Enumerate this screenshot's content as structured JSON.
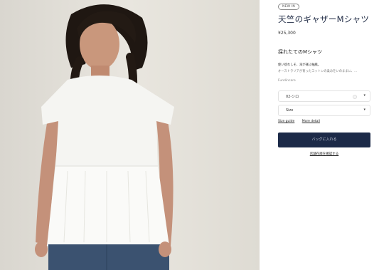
{
  "product": {
    "badge": "NEW IN",
    "title": "天竺のギャザーMシャツ",
    "price": "¥25,300",
    "subtitle": "採れたてのMシャツ",
    "desc_line1": "使い捨れしそ、海が運ぶ抽風。",
    "desc_line2": "オーストラリアが育ったコットンの柔みをいのままに、…",
    "color_label": "Fundincare"
  },
  "selectors": {
    "color": {
      "value": "02-シロ",
      "swatch_color": "#f6f6f6"
    },
    "size": {
      "value": "Size"
    }
  },
  "links": {
    "size_guide": "Size guide",
    "more_detail": "More detail"
  },
  "actions": {
    "add_to_cart": "バッグに入れる",
    "store_stock": "店舗在庫を確認する"
  },
  "colors": {
    "accent_navy": "#1c2a48",
    "title_navy": "#1f2a44",
    "photo_background": "#e4e1da"
  }
}
